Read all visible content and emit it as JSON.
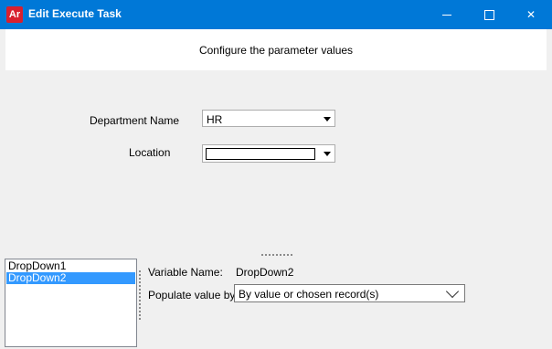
{
  "window": {
    "app_icon": "Ar",
    "title": "Edit Execute Task",
    "controls": [
      "minimize-icon",
      "maximize-icon",
      "close-icon"
    ],
    "close_glyph": "✕"
  },
  "header": {
    "text": "Configure the parameter values"
  },
  "form": {
    "department": {
      "label": "Department Name",
      "value": "HR"
    },
    "location": {
      "label": "Location",
      "value": ""
    }
  },
  "list": {
    "items": [
      "DropDown1",
      "DropDown2"
    ],
    "selected": "DropDown2"
  },
  "details": {
    "variable_name_label": "Variable Name:",
    "variable_name_value": "DropDown2",
    "populate_label": "Populate value by:",
    "populate_value": "By value or chosen record(s)"
  },
  "colors": {
    "titlebar": "#0078d7",
    "selection": "#3399ff",
    "app_icon": "#d8202f"
  }
}
